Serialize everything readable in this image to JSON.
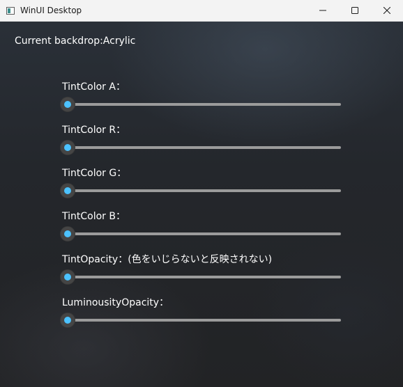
{
  "window": {
    "title": "WinUI Desktop",
    "icon": "app-window-icon",
    "controls": {
      "minimize_icon": "minimize-icon",
      "maximize_icon": "maximize-icon",
      "close_icon": "close-icon"
    }
  },
  "main": {
    "backdrop_label": "Current backdrop:Acrylic",
    "accent_color": "#4cc2ff",
    "sliders": [
      {
        "label": "TintColor A：",
        "value": 0
      },
      {
        "label": "TintColor R：",
        "value": 0
      },
      {
        "label": "TintColor G：",
        "value": 0
      },
      {
        "label": "TintColor B：",
        "value": 0
      },
      {
        "label": "TintOpacity：(色をいじらないと反映されない)",
        "value": 0
      },
      {
        "label": "LuminousityOpacity：",
        "value": 0
      }
    ]
  }
}
